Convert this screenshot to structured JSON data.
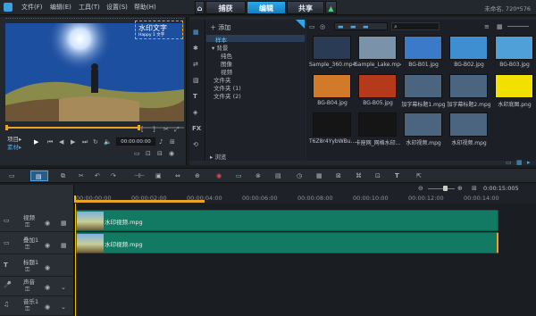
{
  "menu": {
    "items": [
      "文件(F)",
      "编辑(E)",
      "工具(T)",
      "设置(S)",
      "帮助(H)"
    ]
  },
  "tabs": {
    "home": "⌂",
    "capture": "捕获",
    "edit": "编辑",
    "share": "共享",
    "upload": "▲"
  },
  "window": {
    "title": "未命名, 720*576"
  },
  "player": {
    "watermark": "水印文字",
    "watermark_sub": "Happy 1 文字",
    "mode_project": "项目▸",
    "mode_clip": "素材▸",
    "timecode": "00:00:00:00"
  },
  "library": {
    "add_label": "添加",
    "tree": [
      "样本",
      "背景",
      "纯色",
      "图像",
      "视频",
      "文件夹",
      "文件夹 (1)",
      "文件夹 (2)"
    ],
    "browse_label": "浏览",
    "items": [
      {
        "label": "Sample_360.mp4",
        "color": "#2a3b56"
      },
      {
        "label": "Sample_Lake.mp4",
        "color": "#7a93a8"
      },
      {
        "label": "BG-B01.jpg",
        "color": "#3b7ac9"
      },
      {
        "label": "BG-B02.jpg",
        "color": "#3e8fd1"
      },
      {
        "label": "BG-B03.jpg",
        "color": "#4fa0d8"
      },
      {
        "label": "BG-B04.jpg",
        "color": "#d07a2a"
      },
      {
        "label": "BG-B05.jpg",
        "color": "#b53a1c"
      },
      {
        "label": "加字幕标题1.mpg",
        "color": "#4b6580"
      },
      {
        "label": "加字幕标题2.mpg",
        "color": "#4b6580"
      },
      {
        "label": "水印底图.png",
        "color": "#f2e100"
      },
      {
        "label": "T6Z8r4YybWBu...",
        "color": "#151515"
      },
      {
        "label": "卡座网_网格水印...",
        "color": "#151515"
      },
      {
        "label": "水印视频.mpg",
        "color": "#4b6580"
      },
      {
        "label": "水印视频.mpg",
        "color": "#4b6580"
      }
    ]
  },
  "timeline": {
    "ticks": [
      "00:00:00:00",
      "00:00:02:00",
      "00:00:04:00",
      "00:00:06:00",
      "00:00:08:00",
      "00:00:10:00",
      "00:00:12:00",
      "00:00:14:00"
    ],
    "duration": "0:00:15:005",
    "tracks": [
      {
        "name": "视频",
        "clip": "水印视频.mpg"
      },
      {
        "name": "叠加1",
        "clip": "水印视频.mpg"
      },
      {
        "name": "标题1",
        "clip": ""
      },
      {
        "name": "声音",
        "clip": ""
      },
      {
        "name": "音乐1",
        "clip": ""
      }
    ]
  }
}
